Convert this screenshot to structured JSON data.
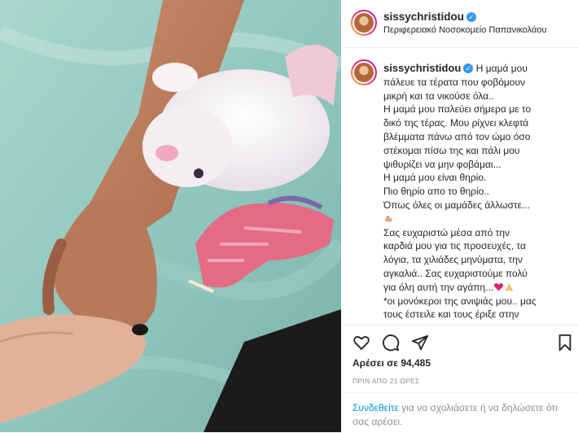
{
  "post": {
    "username": "sissychristidou",
    "verified_icon": "verified-badge-icon",
    "location": "Περιφερειακό Νοσοκομείο Παπανικολάου",
    "caption_lines": [
      "Η μαμά μου",
      "πάλευε τα τέρατα που φοβόμουν",
      "μικρή και τα νικούσε όλα..",
      "Η μαμά μου παλεύει σήμερα με το",
      "δικό της τέρας. Μου ρίχνει κλεφτά",
      "βλέμματα πάνω από τον ώμο όσο",
      "στέκομαι πίσω της και πάλι μου",
      "ψιθυρίζει να μην φοβάμαι...",
      "Η μαμά μου είναι θηρίο.",
      "Πιο θηρίο απο το θηρίο..",
      "Όπως όλες οι μαμάδες άλλωστε...",
      "Σας ευχαριστώ μέσα από την",
      "καρδιά μου για τις προσευχές, τα",
      "λόγια, τα χιλιάδες μηνύματα, την",
      "αγκαλιά.. Σας ευχαριστούμε πολύ",
      "για όλη αυτή την αγάπη...",
      "*οι μονόκεροι της ανιψιάς μου.. μας",
      "τους έστειλε και τους έριξε στην"
    ],
    "emojis": [
      "flexed-biceps-emoji",
      "red-heart-emoji",
      "folded-hands-emoji"
    ],
    "likes": "Αρέσει σε 94,485",
    "time_ago": "ΠΡΙΝ ΑΠΟ 21 ΩΡΕΣ",
    "comment_link": "Συνδεθείτε",
    "comment_rest": " για να σχολιάσετε ή να δηλώσετε ότι σας αρέσει."
  },
  "icons": {
    "like": "heart-icon",
    "comment": "comment-icon",
    "share": "share-icon",
    "save": "bookmark-icon"
  },
  "colors": {
    "link": "#0095f6",
    "verified": "#3897f0",
    "secondary_text": "#8e8e8e",
    "heart_emoji": "#e0245e"
  }
}
